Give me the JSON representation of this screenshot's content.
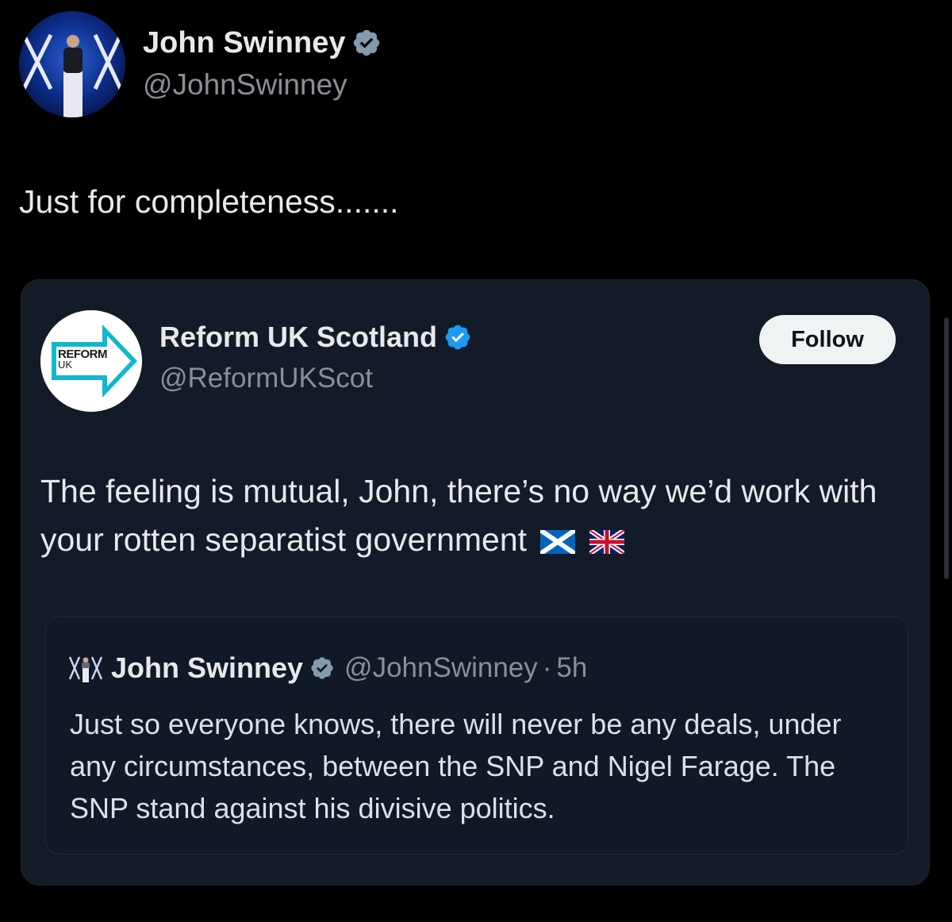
{
  "post": {
    "author": {
      "name": "John Swinney",
      "handle": "@JohnSwinney",
      "verified": "grey"
    },
    "text": "Just for completeness.......",
    "quoted": {
      "author": {
        "name": "Reform UK Scotland",
        "handle": "@ReformUKScot",
        "verified": "blue",
        "avatar_text_line1": "REFORM",
        "avatar_text_line2": "UK"
      },
      "follow_label": "Follow",
      "text": "The feeling is mutual, John, there’s no way we’d work with your rotten separatist government",
      "flags": [
        "scotland-flag-icon",
        "union-jack-flag-icon"
      ],
      "nested": {
        "author_name": "John Swinney",
        "handle": "@JohnSwinney",
        "separator": "·",
        "time": "5h",
        "text": "Just so everyone knows, there will never be any deals, under any circumstances, between the SNP and Nigel Farage. The SNP stand against his divisive politics."
      }
    }
  },
  "colors": {
    "background": "#000000",
    "card": "#141b28",
    "text": "#e7e9ea",
    "muted": "#8b8f94",
    "verified_blue": "#1d9bf0",
    "verified_grey": "#829aab",
    "reform_teal": "#12b6cf"
  }
}
